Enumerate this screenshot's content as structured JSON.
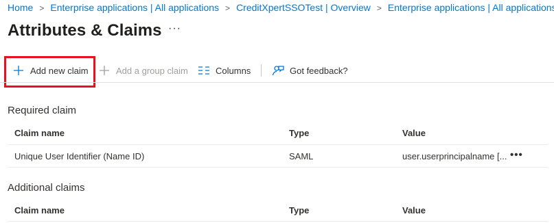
{
  "breadcrumb": {
    "items": [
      "Home",
      "Enterprise applications | All applications",
      "CreditXpertSSOTest | Overview",
      "Enterprise applications | All applications"
    ]
  },
  "page": {
    "title": "Attributes & Claims",
    "more_label": "···"
  },
  "toolbar": {
    "add_new_claim": "Add new claim",
    "add_group_claim": "Add a group claim",
    "columns": "Columns",
    "feedback": "Got feedback?"
  },
  "icons": {
    "add": "plus-icon",
    "add_group": "plus-icon",
    "columns": "columns-icon",
    "feedback": "feedback-person-icon"
  },
  "colors": {
    "link": "#0078d4",
    "highlight": "#e81123",
    "disabled": "#a19f9d"
  },
  "required": {
    "title": "Required claim",
    "headers": {
      "name": "Claim name",
      "type": "Type",
      "value": "Value"
    },
    "rows": [
      {
        "name": "Unique User Identifier (Name ID)",
        "type": "SAML",
        "value": "user.userprincipalname [...",
        "more": "•••"
      }
    ]
  },
  "additional": {
    "title": "Additional claims",
    "headers": {
      "name": "Claim name",
      "type": "Type",
      "value": "Value"
    }
  }
}
